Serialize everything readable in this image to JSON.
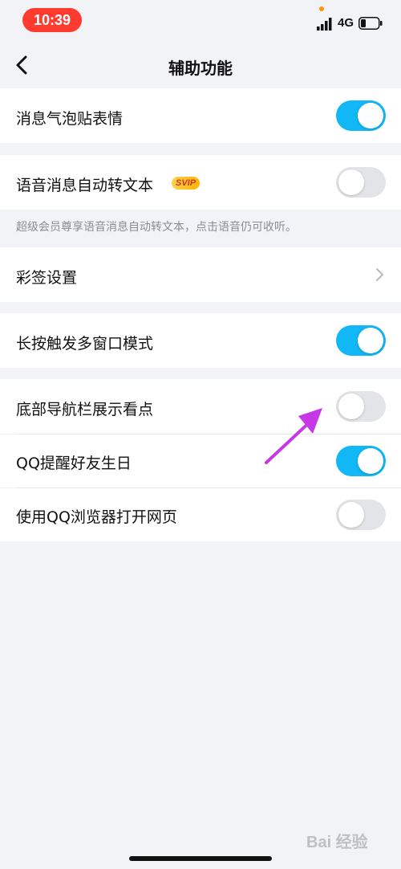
{
  "status_bar": {
    "time": "10:39",
    "network": "4G",
    "icons": [
      "signal-icon",
      "battery-icon"
    ],
    "time_pill_color": "#ff3b30"
  },
  "nav": {
    "back_icon": "chevron-left-icon",
    "title": "辅助功能"
  },
  "settings": {
    "bubble_emoji": {
      "label": "消息气泡贴表情",
      "enabled": true
    },
    "voice_to_text": {
      "label": "语音消息自动转文本",
      "badge": "SVIP",
      "enabled": false,
      "hint": "超级会员尊享语音消息自动转文本，点击语音仍可收听。"
    },
    "color_sign": {
      "label": "彩签设置",
      "icon": "chevron-right-icon"
    },
    "long_press_multiwindow": {
      "label": "长按触发多窗口模式",
      "enabled": true
    },
    "bottom_nav_kandian": {
      "label": "底部导航栏展示看点",
      "enabled": false
    },
    "qq_birthday_reminder": {
      "label": "QQ提醒好友生日",
      "enabled": true
    },
    "qq_browser_open": {
      "label": "使用QQ浏览器打开网页",
      "enabled": false
    }
  },
  "colors": {
    "toggle_on": "#12b7f5",
    "toggle_off": "#e3e4e8",
    "background": "#f2f3f7",
    "annotation_arrow": "#c837e6"
  },
  "watermark": {
    "text": "Bai 经验"
  }
}
